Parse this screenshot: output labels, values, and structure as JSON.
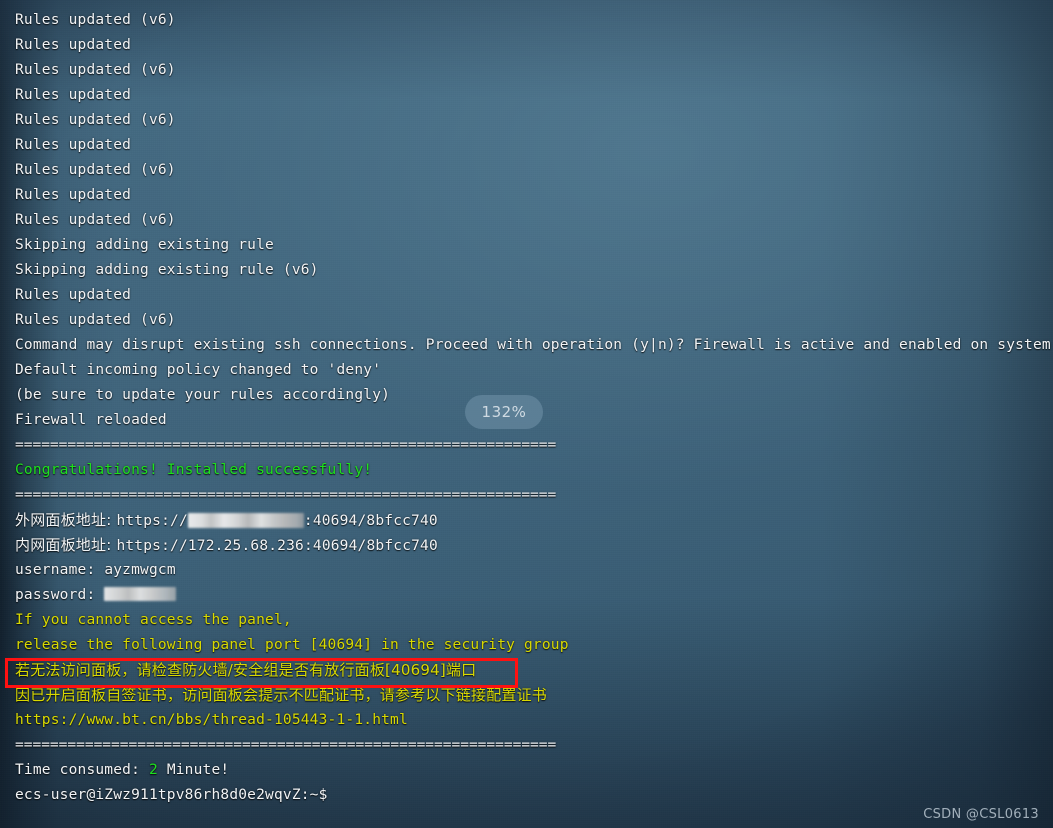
{
  "terminal": {
    "background_color": "#3f647b",
    "text_color": "#f2f4f6",
    "green_color": "#1ee01e",
    "yellow_color": "#d9d900",
    "separator": "==============================================================",
    "lines": [
      "Rules updated (v6)",
      "Rules updated",
      "Rules updated (v6)",
      "Rules updated",
      "Rules updated (v6)",
      "Rules updated",
      "Rules updated (v6)",
      "Rules updated",
      "Rules updated (v6)",
      "Skipping adding existing rule",
      "Skipping adding existing rule (v6)",
      "Rules updated",
      "Rules updated (v6)",
      "Command may disrupt existing ssh connections. Proceed with operation (y|n)? Firewall is active and enabled on system startup",
      "Default incoming policy changed to 'deny'",
      "(be sure to update your rules accordingly)",
      "Firewall reloaded"
    ],
    "congratulations": "Congratulations! Installed successfully!",
    "panel": {
      "external_label": "外网面板地址: ",
      "external_prefix": "https://",
      "external_suffix": ":40694/8bfcc740",
      "internal_label": "内网面板地址: ",
      "internal_url": "https://172.25.68.236:40694/8bfcc740",
      "username_label": "username: ",
      "username_value": "ayzmwgcm",
      "password_label": "password: "
    },
    "warnings": {
      "cannot_access_en_1": "If you cannot access the panel,",
      "cannot_access_en_2": "release the following panel port [40694] in the security group",
      "cannot_access_cn": "若无法访问面板，请检查防火墙/安全组是否有放行面板[40694]端口",
      "cert_cn": "因已开启面板自签证书，访问面板会提示不匹配证书，请参考以下链接配置证书",
      "cert_url": "https://www.bt.cn/bbs/thread-105443-1-1.html"
    },
    "time_consumed": {
      "label": "Time consumed: ",
      "value": "2",
      "unit": " Minute!"
    },
    "prompt": "ecs-user@iZwz911tpv86rh8d0e2wqvZ:~$"
  },
  "overlays": {
    "zoom_level": "132%",
    "watermark": "CSDN @CSL0613",
    "redbox_color": "#ff1111"
  }
}
